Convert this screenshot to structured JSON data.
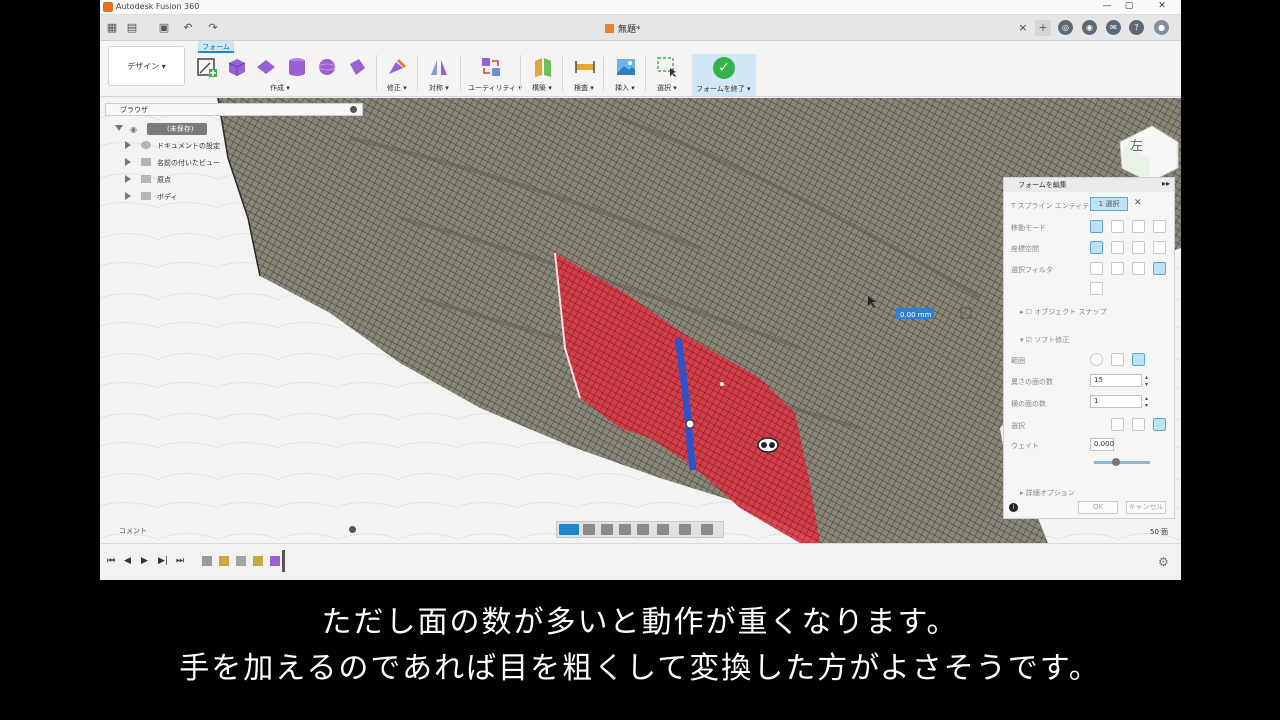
{
  "window": {
    "title": "Autodesk Fusion 360",
    "min": "—",
    "max": "▢",
    "close": "✕"
  },
  "tabbar": {
    "doc_title": "無題*",
    "close": "×",
    "plus": "+"
  },
  "toolbar": {
    "workspace": "デザイン ▾",
    "active_tab": "フォーム",
    "groups": {
      "create": "作成 ▾",
      "modify": "修正 ▾",
      "symmetry": "対称 ▾",
      "utility": "ユーティリティ ▾",
      "construct": "構築 ▾",
      "inspect": "検査 ▾",
      "insert": "挿入 ▾",
      "select": "選択 ▾",
      "finish": "フォームを終了 ▾"
    }
  },
  "browser": {
    "title": "ブラウザ",
    "root": "(未保存)",
    "items": [
      "ドキュメントの設定",
      "名前の付いたビュー",
      "原点",
      "ボディ"
    ]
  },
  "viewcube": {
    "face": "左"
  },
  "dimension_input": {
    "value": "0.00 mm"
  },
  "form_panel": {
    "title": "フォームを編集",
    "rows": {
      "t_spline": "T スプライン エンティティ",
      "chip": "1 選択",
      "mode": "移動モード",
      "coord": "座標空間",
      "filter": "選択フィルタ",
      "object_snap": "オブジェクト スナップ",
      "soft_mod": "ソフト修正",
      "range": "範囲",
      "outer_faces": "異さの面の数",
      "inner_faces": "横の面の数",
      "select": "選択",
      "weight": "ウェイト",
      "detail": "詳細オプション"
    },
    "values": {
      "outer_faces": "15",
      "inner_faces": "1",
      "weight": "0.000"
    },
    "slider_level": 0.4,
    "ok": "OK",
    "cancel": "キャンセル"
  },
  "bottom": {
    "comment": "コメント",
    "face_count": "50 面"
  },
  "subtitles": [
    "ただし面の数が多いと動作が重くなります。",
    "手を加えるのであれば目を粗くして変換した方がよさそうです。"
  ],
  "colors": {
    "accent": "#1e88cf",
    "finish_green": "#36b24a",
    "selection_red": "#d42a36",
    "mesh": "#8a8678"
  }
}
